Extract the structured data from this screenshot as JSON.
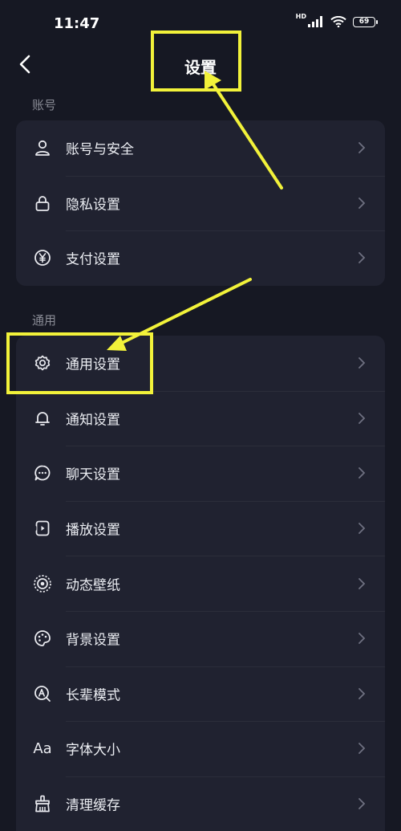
{
  "status_bar": {
    "time": "11:47",
    "network": "HD",
    "battery": "69",
    "icons": [
      "signal-icon",
      "wifi-icon",
      "battery-icon"
    ]
  },
  "header": {
    "title": "设置",
    "back_icon": "back-arrow-icon"
  },
  "sections": [
    {
      "label": "账号",
      "items": [
        {
          "label": "账号与安全",
          "icon": "user-icon"
        },
        {
          "label": "隐私设置",
          "icon": "lock-icon"
        },
        {
          "label": "支付设置",
          "icon": "yen-icon"
        }
      ]
    },
    {
      "label": "通用",
      "items": [
        {
          "label": "通用设置",
          "icon": "gear-icon"
        },
        {
          "label": "通知设置",
          "icon": "bell-icon"
        },
        {
          "label": "聊天设置",
          "icon": "chat-bubble-icon"
        },
        {
          "label": "播放设置",
          "icon": "play-settings-icon"
        },
        {
          "label": "动态壁纸",
          "icon": "dynamic-wallpaper-icon"
        },
        {
          "label": "背景设置",
          "icon": "palette-icon"
        },
        {
          "label": "长辈模式",
          "icon": "elder-mode-icon"
        },
        {
          "label": "字体大小",
          "icon": "font-size-icon",
          "icon_text": "Aa"
        },
        {
          "label": "清理缓存",
          "icon": "broom-icon"
        }
      ]
    }
  ],
  "colors": {
    "background": "#161823",
    "card": "#202230",
    "annotation": "#f2f23a"
  }
}
